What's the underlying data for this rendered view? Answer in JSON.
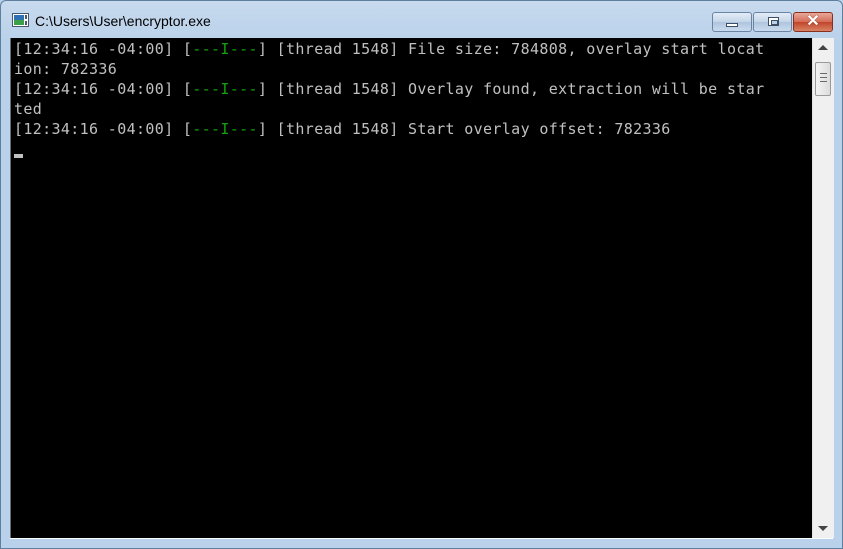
{
  "window": {
    "title": "C:\\Users\\User\\encryptor.exe",
    "icon": "console-app-icon",
    "controls": {
      "minimize": "minimize-icon",
      "maximize": "restore-icon",
      "close": "close-icon",
      "close_glyph": "✕"
    }
  },
  "console": {
    "lines": [
      {
        "prefix": "[12:34:16 -04:00] [",
        "tag": "---I---",
        "suffix": "] [thread 1548] File size: 784808, overlay start locat"
      },
      {
        "text": "ion: 782336"
      },
      {
        "prefix": "[12:34:16 -04:00] [",
        "tag": "---I---",
        "suffix": "] [thread 1548] Overlay found, extraction will be star"
      },
      {
        "text": "ted"
      },
      {
        "prefix": "[12:34:16 -04:00] [",
        "tag": "---I---",
        "suffix": "] [thread 1548] Start overlay offset: 782336"
      }
    ],
    "text_color": "#c0c0c0",
    "tag_color": "#13a10e",
    "background": "#000000"
  },
  "scrollbar": {
    "position": 0
  }
}
